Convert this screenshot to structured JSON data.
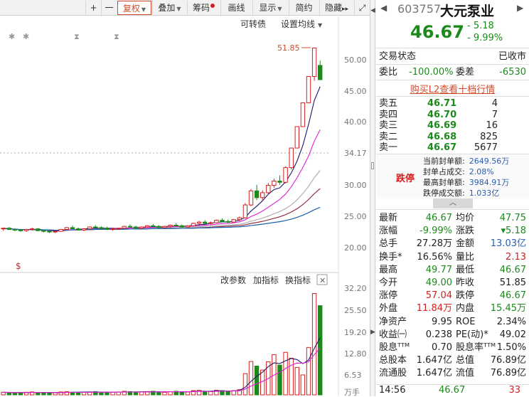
{
  "toolbar": {
    "plus": "+",
    "minus": "一",
    "fuquan": "复权",
    "diejia": "叠加",
    "chouma": "筹码",
    "huaxian": "画线",
    "xianshi": "显示",
    "jianyue": "简约",
    "yincang": "隐藏",
    "more": "▸▸",
    "fullscreen": "⤢"
  },
  "chart": {
    "kezhuanzhai": "可转债",
    "settings": "设置均线",
    "peak_label": "51.85",
    "price_ticks": [
      "50.00",
      "45.00",
      "40.00",
      "34.17",
      "30.00",
      "25.00",
      "20.00"
    ],
    "vol_ticks": [
      "32.20",
      "25.50",
      "19.20",
      "12.80",
      "6.53",
      "万手"
    ],
    "change_params": "改参数",
    "add_indicator": "加指标",
    "switch_indicator": "换指标",
    "close_x": "✕",
    "star": "✱",
    "marker_s": "$",
    "hourglass": "⧗"
  },
  "quote": {
    "code": "603757",
    "name": "大元泵业",
    "price": "46.67",
    "change": "- 5.18",
    "change_pct": "- 9.99%",
    "status_label": "交易状态",
    "status_value": "已收市",
    "weibi_label": "委比",
    "weibi_value": "-100.00%",
    "weicha_label": "委差",
    "weicha_value": "-6530",
    "l2_link": "购买L2查看十档行情"
  },
  "asks": [
    {
      "label": "卖五",
      "price": "46.71",
      "vol": "4"
    },
    {
      "label": "卖四",
      "price": "46.70",
      "vol": "7"
    },
    {
      "label": "卖三",
      "price": "46.69",
      "vol": "16"
    },
    {
      "label": "卖二",
      "price": "46.68",
      "vol": "825"
    },
    {
      "label": "卖一",
      "price": "46.67",
      "vol": "5677"
    }
  ],
  "limit_box": {
    "tag": "跌停",
    "rows": [
      {
        "label": "当前封单额:",
        "value": "2649.56万"
      },
      {
        "label": "封单占成交:",
        "value": "2.08%"
      },
      {
        "label": "最高封单额:",
        "value": "3984.91万"
      },
      {
        "label": "跌停成交额:",
        "value": "1.033亿"
      }
    ],
    "collapse": "︿"
  },
  "stats": [
    {
      "l1": "最新",
      "v1": "46.67",
      "c1": "green",
      "l2": "均价",
      "v2": "47.75",
      "c2": "green"
    },
    {
      "l1": "涨幅",
      "v1": "-9.99%",
      "c1": "green",
      "l2": "涨跌",
      "v2": "▾5.18",
      "c2": "green"
    },
    {
      "l1": "总手",
      "v1": "27.28万",
      "c1": "",
      "l2": "金额",
      "v2": "13.03亿",
      "c2": "blue"
    },
    {
      "l1": "换手*",
      "v1": "16.56%",
      "c1": "",
      "l2": "量比",
      "v2": "2.13",
      "c2": "red"
    },
    {
      "l1": "最高",
      "v1": "49.77",
      "c1": "green",
      "l2": "最低",
      "v2": "46.67",
      "c2": "green"
    },
    {
      "l1": "今开",
      "v1": "49.00",
      "c1": "green",
      "l2": "昨收",
      "v2": "51.85",
      "c2": ""
    },
    {
      "l1": "涨停",
      "v1": "57.04",
      "c1": "red",
      "l2": "跌停",
      "v2": "46.67",
      "c2": "green"
    },
    {
      "l1": "外盘",
      "v1": "11.84万",
      "c1": "red",
      "l2": "内盘",
      "v2": "15.45万",
      "c2": "green"
    },
    {
      "l1": "净资产",
      "v1": "9.95",
      "c1": "",
      "l2": "ROE",
      "v2": "2.34%",
      "c2": ""
    },
    {
      "l1": "收益㈠",
      "v1": "0.238",
      "c1": "",
      "l2": "PE(动)*",
      "v2": "49.02",
      "c2": ""
    },
    {
      "l1": "股息ᵀᵀᴹ",
      "v1": "0.70",
      "c1": "",
      "l2": "股息率ᵀᵀᴹ",
      "v2": "1.50%",
      "c2": ""
    },
    {
      "l1": "总股本",
      "v1": "1.647亿",
      "c1": "",
      "l2": "总值",
      "v2": "76.89亿",
      "c2": ""
    },
    {
      "l1": "流通股",
      "v1": "1.647亿",
      "c1": "",
      "l2": "流值",
      "v2": "76.89亿",
      "c2": ""
    }
  ],
  "tick": {
    "time": "14:56",
    "price": "46.67",
    "vol": "33"
  },
  "colors": {
    "up": "#d42020",
    "down": "#1b8a1b",
    "accent": "#d24a2a"
  },
  "chart_data": {
    "type": "candlestick",
    "price_axis": [
      20,
      50
    ],
    "candles": [
      [
        22.3,
        22.5,
        22.0,
        22.4
      ],
      [
        22.4,
        22.6,
        22.1,
        22.2
      ],
      [
        22.2,
        22.4,
        21.9,
        22.1
      ],
      [
        22.1,
        22.3,
        21.8,
        22.0
      ],
      [
        22.0,
        22.3,
        21.8,
        22.2
      ],
      [
        22.2,
        22.5,
        22.0,
        22.3
      ],
      [
        22.3,
        22.4,
        21.9,
        22.0
      ],
      [
        22.0,
        22.2,
        21.7,
        21.9
      ],
      [
        21.9,
        22.1,
        21.6,
        21.8
      ],
      [
        21.8,
        22.0,
        21.6,
        21.9
      ],
      [
        21.9,
        22.3,
        21.8,
        22.2
      ],
      [
        22.2,
        22.6,
        22.1,
        22.5
      ],
      [
        22.5,
        22.8,
        22.2,
        22.3
      ],
      [
        22.3,
        22.5,
        22.0,
        22.1
      ],
      [
        22.1,
        22.4,
        21.9,
        22.3
      ],
      [
        22.3,
        22.7,
        22.2,
        22.6
      ],
      [
        22.6,
        22.9,
        22.4,
        22.5
      ],
      [
        22.5,
        22.7,
        22.2,
        22.4
      ],
      [
        22.4,
        22.6,
        22.1,
        22.2
      ],
      [
        22.2,
        22.4,
        22.0,
        22.3
      ],
      [
        22.3,
        22.5,
        22.1,
        22.4
      ],
      [
        22.4,
        22.8,
        22.3,
        22.7
      ],
      [
        22.7,
        23.0,
        22.5,
        22.6
      ],
      [
        22.6,
        22.8,
        22.3,
        22.4
      ],
      [
        22.4,
        22.7,
        22.2,
        22.6
      ],
      [
        22.6,
        22.9,
        22.5,
        22.8
      ],
      [
        22.8,
        23.1,
        22.6,
        22.7
      ],
      [
        22.7,
        22.9,
        22.4,
        22.5
      ],
      [
        22.5,
        22.8,
        22.3,
        22.7
      ],
      [
        22.7,
        23.0,
        22.5,
        22.9
      ],
      [
        22.9,
        23.2,
        22.7,
        22.8
      ],
      [
        22.8,
        23.0,
        22.5,
        22.6
      ],
      [
        22.6,
        22.9,
        22.4,
        22.8
      ],
      [
        22.8,
        23.3,
        22.7,
        23.2
      ],
      [
        23.2,
        23.6,
        23.0,
        23.4
      ],
      [
        23.4,
        23.7,
        23.1,
        23.2
      ],
      [
        23.2,
        23.5,
        22.9,
        23.3
      ],
      [
        23.3,
        23.8,
        23.2,
        23.7
      ],
      [
        23.7,
        24.0,
        23.4,
        23.5
      ],
      [
        23.5,
        23.8,
        23.2,
        23.4
      ],
      [
        23.4,
        23.9,
        23.3,
        23.8
      ],
      [
        23.8,
        24.3,
        23.6,
        24.1
      ],
      [
        24.1,
        26.5,
        24.0,
        26.2
      ],
      [
        26.2,
        28.8,
        26.0,
        28.5
      ],
      [
        28.5,
        29.5,
        27.0,
        27.4
      ],
      [
        27.4,
        28.6,
        26.8,
        28.2
      ],
      [
        28.2,
        29.8,
        27.9,
        29.4
      ],
      [
        29.4,
        30.5,
        29.0,
        30.1
      ],
      [
        30.1,
        31.0,
        29.5,
        29.9
      ],
      [
        29.9,
        32.5,
        29.7,
        32.3
      ],
      [
        32.3,
        35.5,
        32.0,
        35.5
      ],
      [
        35.5,
        39.0,
        35.5,
        39.0
      ],
      [
        39.0,
        42.9,
        39.0,
        42.9
      ],
      [
        42.9,
        47.2,
        42.9,
        47.2
      ],
      [
        47.2,
        51.9,
        46.5,
        51.85
      ],
      [
        49.0,
        49.77,
        46.67,
        46.67
      ]
    ],
    "volume": [
      0.8,
      0.7,
      0.6,
      0.7,
      0.8,
      0.9,
      0.7,
      0.6,
      0.6,
      0.7,
      0.9,
      1.0,
      0.8,
      0.7,
      0.8,
      0.9,
      1.0,
      0.8,
      0.7,
      0.8,
      0.9,
      1.1,
      1.0,
      0.8,
      0.9,
      1.0,
      1.1,
      0.9,
      0.8,
      1.0,
      1.1,
      0.9,
      0.9,
      1.3,
      1.4,
      1.1,
      1.0,
      1.4,
      1.3,
      1.1,
      1.3,
      1.6,
      6.5,
      10.2,
      8.8,
      7.6,
      10.1,
      12.3,
      9.1,
      13.0,
      11.2,
      8.4,
      6.1,
      14.5,
      31.0,
      27.28
    ]
  }
}
